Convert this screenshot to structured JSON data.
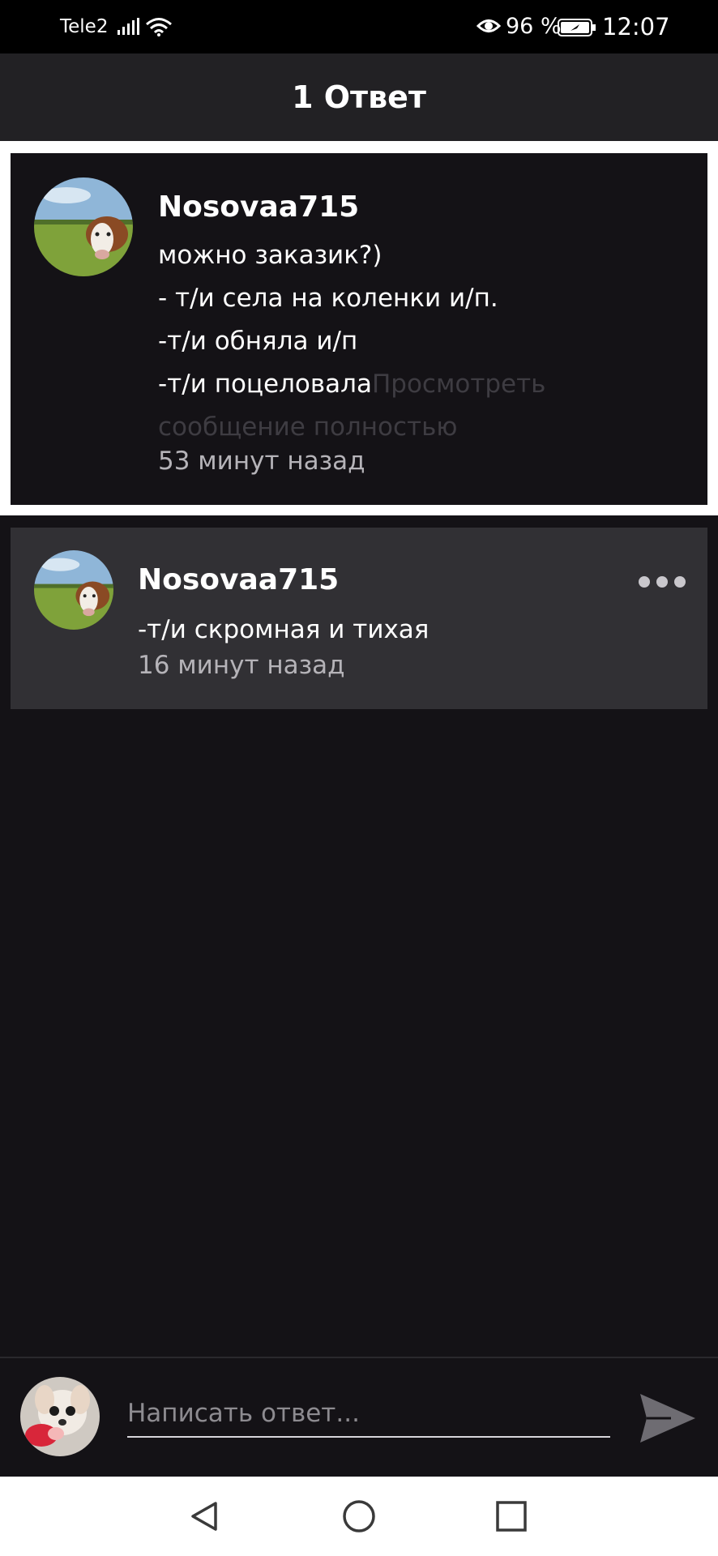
{
  "status_bar": {
    "carrier": "Tele2",
    "battery_percent": "96 %",
    "time": "12:07",
    "icons": [
      "signal-icon",
      "wifi-icon",
      "eye-icon",
      "battery-icon"
    ]
  },
  "header": {
    "title": "1 Ответ"
  },
  "parent_comment": {
    "author": "Nosovaa715",
    "lines": [
      "можно заказик?)",
      "- т/и села на коленки и/п.",
      "-т/и обняла и/п",
      "-т/и поцеловала"
    ],
    "more_link_line1": "Просмотреть",
    "more_link_line2": "сообщение полностью",
    "time": "53 минут назад"
  },
  "replies": [
    {
      "author": "Nosovaa715",
      "text": "-т/и скромная и тихая",
      "time": "16 минут назад",
      "menu_icon": "more-dots-icon"
    }
  ],
  "composer": {
    "placeholder": "Написать ответ...",
    "send_icon": "send-icon"
  },
  "nav_bar": {
    "icons": [
      "back-triangle-icon",
      "home-circle-icon",
      "recents-square-icon"
    ]
  },
  "colors": {
    "background": "#141216",
    "header": "#222124",
    "reply_card": "#313034",
    "secondary_text": "#b5b3b8",
    "faded_text": "#3e3c42"
  }
}
